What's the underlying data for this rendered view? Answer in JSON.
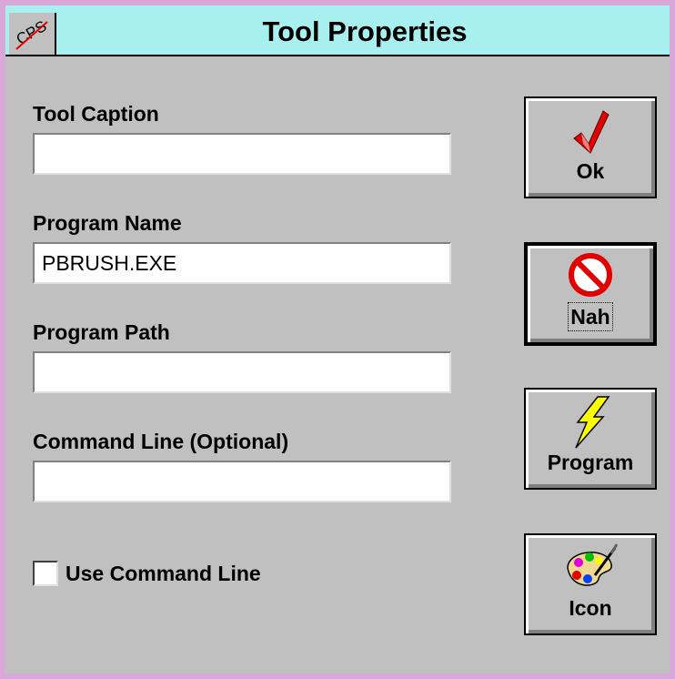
{
  "window": {
    "title": "Tool Properties",
    "sysmenu_text": "CPS",
    "sysmenu_icon": "cps-icon"
  },
  "form": {
    "tool_caption": {
      "label": "Tool Caption",
      "value": ""
    },
    "program_name": {
      "label": "Program Name",
      "value": "PBRUSH.EXE"
    },
    "program_path": {
      "label": "Program Path",
      "value": ""
    },
    "command_line": {
      "label": "Command Line (Optional)",
      "value": ""
    },
    "use_command_line": {
      "label": "Use Command Line",
      "checked": false
    }
  },
  "buttons": {
    "ok": {
      "label": "Ok",
      "icon": "checkmark-icon"
    },
    "nah": {
      "label": "Nah",
      "icon": "no-sign-icon"
    },
    "program": {
      "label": "Program",
      "icon": "lightning-icon"
    },
    "icon": {
      "label": "Icon",
      "icon": "palette-icon"
    }
  },
  "colors": {
    "titlebar": "#a8f0f0",
    "frame": "#d8a8d8",
    "face": "#c0c0c0"
  }
}
